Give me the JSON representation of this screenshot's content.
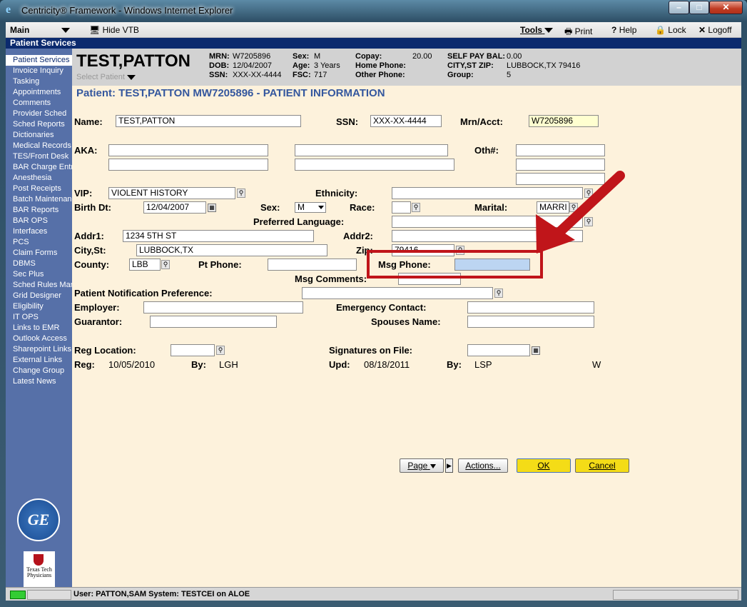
{
  "window": {
    "title": "Centricity® Framework - Windows Internet Explorer",
    "min": "–",
    "max": "□",
    "close": "✕"
  },
  "menu": {
    "main": "Main",
    "hide_vtb": "Hide VTB",
    "tools": "Tools",
    "print": "Print",
    "help": "Help",
    "lock": "Lock",
    "logoff": "Logoff"
  },
  "service_bar": "Patient Services",
  "sidebar": {
    "items": [
      "Patient Services",
      "Invoice Inquiry",
      "Tasking",
      "Appointments",
      "Comments",
      "Provider Sched",
      "Sched Reports",
      "Dictionaries",
      "Medical Records",
      "TES/Front Desk",
      "BAR Charge Entry",
      "Anesthesia",
      "Post Receipts",
      "Batch Maintenance",
      "BAR Reports",
      "BAR OPS",
      "Interfaces",
      "PCS",
      "Claim Forms",
      "DBMS",
      "Sec Plus",
      "Sched Rules Manager",
      "Grid Designer",
      "Eligibility",
      "IT OPS",
      "Links to EMR",
      "Outlook Access",
      "Sharepoint Links",
      "External Links",
      "Change Group",
      "Latest News"
    ],
    "ge_logo": "GE",
    "ttp_logo": "Texas Tech Physicians"
  },
  "header": {
    "patient_name": "TEST,PATTON",
    "select_patient": "Select Patient",
    "mrn_label": "MRN:",
    "mrn": "W7205896",
    "dob_label": "DOB:",
    "dob": "12/04/2007",
    "ssn_label": "SSN:",
    "ssn": "XXX-XX-4444",
    "sex_label": "Sex:",
    "sex": "M",
    "age_label": "Age:",
    "age": "3 Years",
    "fsc_label": "FSC:",
    "fsc": "717",
    "copay_label": "Copay:",
    "copay": "20.00",
    "home_phone_label": "Home Phone:",
    "other_phone_label": "Other Phone:",
    "self_pay_label": "SELF PAY BAL:",
    "self_pay": "0.00",
    "city_zip_label": "CITY,ST ZIP:",
    "city_zip": "LUBBOCK,TX 79416",
    "group_label": "Group:",
    "group": "5"
  },
  "page_title": "Patient: TEST,PATTON  MW7205896 - PATIENT INFORMATION",
  "form": {
    "name_label": "Name:",
    "name": "TEST,PATTON",
    "ssn_label": "SSN:",
    "ssn": "XXX-XX-4444",
    "mrn_label": "Mrn/Acct:",
    "mrn": "W7205896",
    "aka_label": "AKA:",
    "oth_label": "Oth#:",
    "vip_label": "VIP:",
    "vip": "VIOLENT HISTORY",
    "ethnicity_label": "Ethnicity:",
    "birth_label": "Birth Dt:",
    "birth": "12/04/2007",
    "sex_label": "Sex:",
    "sex": "M",
    "race_label": "Race:",
    "marital_label": "Marital:",
    "marital": "MARRI",
    "pref_lang_label": "Preferred Language:",
    "addr1_label": "Addr1:",
    "addr1": "1234 5TH ST",
    "addr2_label": "Addr2:",
    "city_label": "City,St:",
    "city": "LUBBOCK,TX",
    "zip_label": "Zip:",
    "zip": "79416",
    "county_label": "County:",
    "county": "LBB",
    "pt_phone_label": "Pt Phone:",
    "msg_phone_label": "Msg Phone:",
    "msg_comments_label": "Msg Comments:",
    "notif_label": "Patient Notification Preference:",
    "employer_label": "Employer:",
    "emergency_label": "Emergency Contact:",
    "guarantor_label": "Guarantor:",
    "spouse_label": "Spouses Name:",
    "reg_loc_label": "Reg Location:",
    "sig_label": "Signatures on File:",
    "reg_label": "Reg:",
    "reg": "10/05/2010",
    "by_label": "By:",
    "reg_by": "LGH",
    "upd_label": "Upd:",
    "upd": "08/18/2011",
    "by2_label": "By:",
    "upd_by": "LSP",
    "w": "W"
  },
  "buttons": {
    "page": "Page",
    "actions": "Actions...",
    "ok": "OK",
    "cancel": "Cancel"
  },
  "status": {
    "user": "User: PATTON,SAM  System: TESTCEI on ALOE"
  },
  "colors": {
    "highlight": "#c0151a",
    "service_bar": "#0b2a6e",
    "sidebar": "#5670a8",
    "content": "#fdf2dc"
  }
}
